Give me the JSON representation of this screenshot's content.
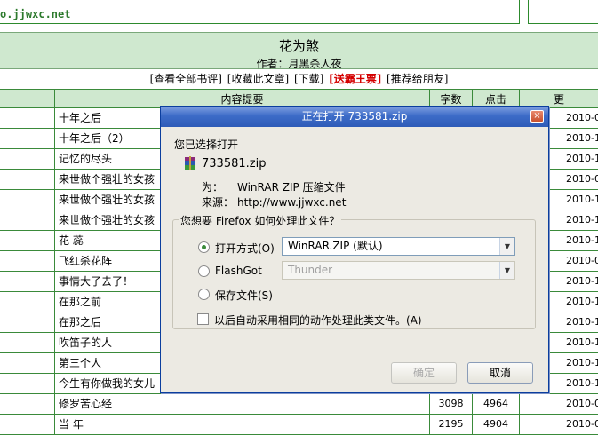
{
  "site": {
    "url": "o.jjwxc.net"
  },
  "novel": {
    "title": "花为煞",
    "author": "作者：月黑杀人夜"
  },
  "links": [
    "[查看全部书评]",
    "[收藏此文章]",
    "[下载]",
    "[送霸王票]",
    "[推荐给朋友]"
  ],
  "table": {
    "headers": [
      "",
      "内容提要",
      "字数",
      "点击",
      "更"
    ],
    "rows": [
      {
        "summary": "十年之后",
        "words": "",
        "clicks": "",
        "date": "2010-0"
      },
      {
        "summary": "十年之后（2）",
        "words": "",
        "clicks": "",
        "date": "2010-1"
      },
      {
        "summary": "记忆的尽头",
        "words": "",
        "clicks": "",
        "date": "2010-1"
      },
      {
        "summary": "来世做个强壮的女孩（",
        "words": "",
        "clicks": "",
        "date": "2010-0"
      },
      {
        "summary": "来世做个强壮的女孩（",
        "words": "",
        "clicks": "",
        "date": "2010-1"
      },
      {
        "summary": "来世做个强壮的女孩（",
        "words": "",
        "clicks": "",
        "date": "2010-1"
      },
      {
        "summary": "花 蕊",
        "words": "",
        "clicks": "",
        "date": "2010-1"
      },
      {
        "summary": "飞红杀花阵",
        "words": "",
        "clicks": "",
        "date": "2010-0"
      },
      {
        "summary": "事情大了去了！",
        "words": "",
        "clicks": "",
        "date": "2010-1"
      },
      {
        "summary": "在那之前",
        "words": "",
        "clicks": "",
        "date": "2010-1"
      },
      {
        "summary": "在那之后",
        "words": "",
        "clicks": "",
        "date": "2010-1"
      },
      {
        "summary": "吹笛子的人",
        "words": "",
        "clicks": "",
        "date": "2010-1"
      },
      {
        "summary": "第三个人",
        "words": "",
        "clicks": "",
        "date": "2010-1"
      },
      {
        "summary": "今生有你做我的女儿",
        "words": "",
        "clicks": "",
        "date": "2010-1"
      },
      {
        "summary": "修罗苦心经",
        "words": "3098",
        "clicks": "4964",
        "date": "2010-0"
      },
      {
        "summary": "当 年",
        "words": "2195",
        "clicks": "4904",
        "date": "2010-0"
      }
    ]
  },
  "dialog": {
    "title": "正在打开 733581.zip",
    "close_icon": "×",
    "intro": "您已选择打开",
    "file_name": "733581.zip",
    "type_key": "为：",
    "type_value": "WinRAR ZIP 压缩文件",
    "source_key": "来源：",
    "source_value": "http://www.jjwxc.net",
    "group_title": "您想要 Firefox 如何处理此文件？",
    "open_with_label": "打开方式(O)",
    "open_with_value": "WinRAR.ZIP (默认)",
    "flashgot_label": "FlashGot",
    "flashgot_value": "Thunder",
    "save_label": "保存文件(S)",
    "auto_label": "以后自动采用相同的动作处理此类文件。(A)",
    "ok_label": "确定",
    "cancel_label": "取消",
    "arrow_icon": "▼"
  },
  "colors": {
    "accent_green": "#2d8a2d",
    "header_bg": "#cfe8cf",
    "titlebar": "#3d6cc8",
    "highlight_red": "#d40000"
  }
}
